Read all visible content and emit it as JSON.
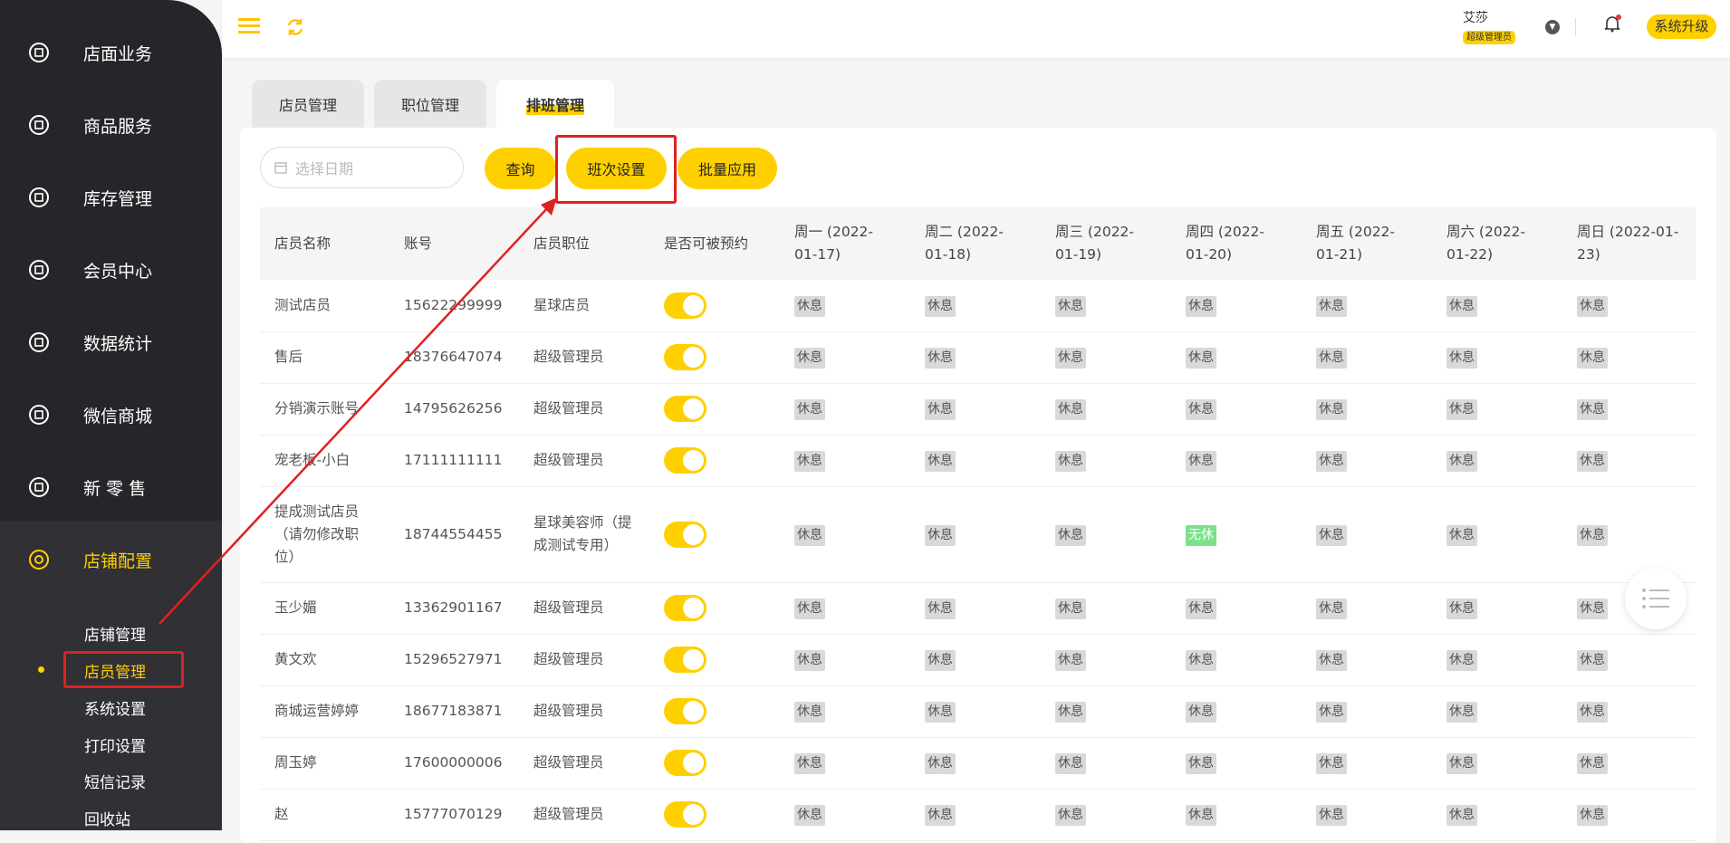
{
  "sidebar": {
    "items": [
      {
        "label": "店面业务",
        "icon": "store-icon"
      },
      {
        "label": "商品服务",
        "icon": "bag-icon"
      },
      {
        "label": "库存管理",
        "icon": "box-icon"
      },
      {
        "label": "会员中心",
        "icon": "member-icon"
      },
      {
        "label": "数据统计",
        "icon": "chart-icon"
      },
      {
        "label": "微信商城",
        "icon": "wechat-icon"
      },
      {
        "label": "新 零 售",
        "icon": "cube-icon"
      },
      {
        "label": "店铺配置",
        "icon": "settings-icon"
      }
    ],
    "sub_items": [
      "店铺管理",
      "店员管理",
      "系统设置",
      "打印设置",
      "短信记录",
      "回收站"
    ]
  },
  "header": {
    "user_name": "艾莎",
    "user_role": "超级管理员",
    "upgrade_label": "系统升级"
  },
  "tabs": [
    "店员管理",
    "职位管理",
    "排班管理"
  ],
  "toolbar": {
    "date_placeholder": "选择日期",
    "query_label": "查询",
    "shift_label": "班次设置",
    "batch_label": "批量应用"
  },
  "table": {
    "columns": [
      "店员名称",
      "账号",
      "店员职位",
      "是否可被预约",
      "周一 (2022-01-17)",
      "周二 (2022-01-18)",
      "周三 (2022-01-19)",
      "周四 (2022-01-20)",
      "周五 (2022-01-21)",
      "周六 (2022-01-22)",
      "周日 (2022-01-23)"
    ],
    "rows": [
      {
        "name": "测试店员",
        "account": "15622299999",
        "position": "星球店员",
        "days": [
          "休息",
          "休息",
          "休息",
          "休息",
          "休息",
          "休息",
          "休息"
        ]
      },
      {
        "name": "售后",
        "account": "18376647074",
        "position": "超级管理员",
        "days": [
          "休息",
          "休息",
          "休息",
          "休息",
          "休息",
          "休息",
          "休息"
        ]
      },
      {
        "name": "分销演示账号",
        "account": "14795626256",
        "position": "超级管理员",
        "days": [
          "休息",
          "休息",
          "休息",
          "休息",
          "休息",
          "休息",
          "休息"
        ]
      },
      {
        "name": "宠老板-小白",
        "account": "17111111111",
        "position": "超级管理员",
        "days": [
          "休息",
          "休息",
          "休息",
          "休息",
          "休息",
          "休息",
          "休息"
        ]
      },
      {
        "name": "提成测试店员（请勿修改职位）",
        "account": "18744554455",
        "position": "星球美容师（提成测试专用）",
        "days": [
          "休息",
          "休息",
          "休息",
          "无休",
          "休息",
          "休息",
          "休息"
        ]
      },
      {
        "name": "玉少媚",
        "account": "13362901167",
        "position": "超级管理员",
        "days": [
          "休息",
          "休息",
          "休息",
          "休息",
          "休息",
          "休息",
          "休息"
        ]
      },
      {
        "name": "黄文欢",
        "account": "15296527971",
        "position": "超级管理员",
        "days": [
          "休息",
          "休息",
          "休息",
          "休息",
          "休息",
          "休息",
          "休息"
        ]
      },
      {
        "name": "商城运营婷婷",
        "account": "18677183871",
        "position": "超级管理员",
        "days": [
          "休息",
          "休息",
          "休息",
          "休息",
          "休息",
          "休息",
          "休息"
        ]
      },
      {
        "name": "周玉婷",
        "account": "17600000006",
        "position": "超级管理员",
        "days": [
          "休息",
          "休息",
          "休息",
          "休息",
          "休息",
          "休息",
          "休息"
        ]
      },
      {
        "name": "赵",
        "account": "15777070129",
        "position": "超级管理员",
        "days": [
          "休息",
          "休息",
          "休息",
          "休息",
          "休息",
          "休息",
          "休息"
        ]
      }
    ]
  },
  "colors": {
    "accent": "#ffd000",
    "sidebar": "#26262a",
    "highlight": "#e02020"
  }
}
